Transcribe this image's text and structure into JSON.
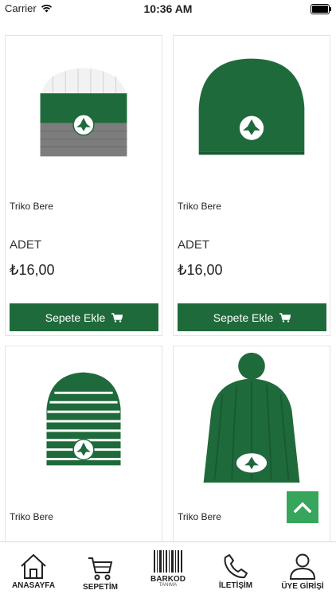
{
  "status": {
    "carrier": "Carrier",
    "time": "10:36 AM"
  },
  "products": [
    {
      "name": "Triko Bere",
      "unit": "ADET",
      "price": "₺16,00",
      "button": "Sepete Ekle"
    },
    {
      "name": "Triko Bere",
      "unit": "ADET",
      "price": "₺16,00",
      "button": "Sepete Ekle"
    },
    {
      "name": "Triko Bere"
    },
    {
      "name": "Triko Bere"
    }
  ],
  "tabs": [
    {
      "label": "ANASAYFA",
      "icon": "home-icon"
    },
    {
      "label": "SEPETİM",
      "icon": "cart-icon"
    },
    {
      "label": "BARKOD",
      "sub": "TANIMA",
      "icon": "barcode-icon"
    },
    {
      "label": "İLETİŞİM",
      "icon": "phone-icon"
    },
    {
      "label": "ÜYE GİRİŞİ",
      "icon": "user-icon"
    }
  ],
  "colors": {
    "brand_green": "#1f6a3b",
    "scroll_button": "#37a55c"
  }
}
